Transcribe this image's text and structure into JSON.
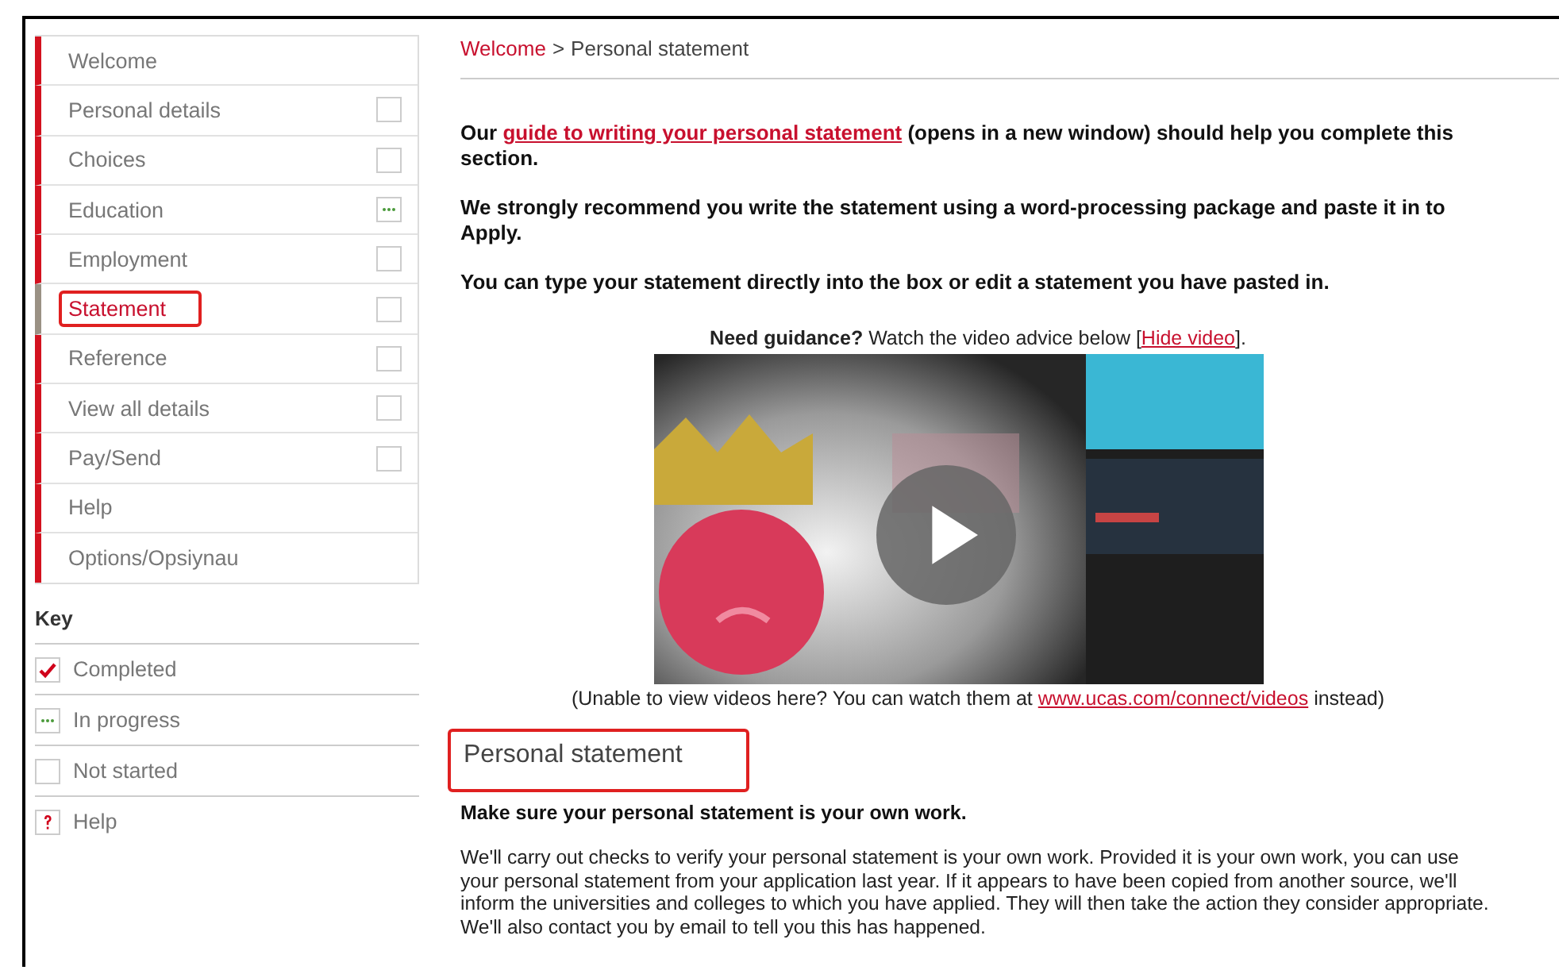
{
  "sidebar": {
    "items": [
      {
        "label": "Welcome",
        "kind": "plain",
        "selected": false,
        "highlighted": false
      },
      {
        "label": "Personal details",
        "kind": "unstarted",
        "selected": false,
        "highlighted": false
      },
      {
        "label": "Choices",
        "kind": "unstarted",
        "selected": false,
        "highlighted": false
      },
      {
        "label": "Education",
        "kind": "underway",
        "selected": false,
        "highlighted": false
      },
      {
        "label": "Employment",
        "kind": "unstarted",
        "selected": false,
        "highlighted": false
      },
      {
        "label": "Statement",
        "kind": "unstarted",
        "selected": true,
        "highlighted": true
      },
      {
        "label": "Reference",
        "kind": "unstarted",
        "selected": false,
        "highlighted": false
      },
      {
        "label": "View all details",
        "kind": "unstarted",
        "selected": false,
        "highlighted": false
      },
      {
        "label": "Pay/Send",
        "kind": "unstarted",
        "selected": false,
        "highlighted": false
      },
      {
        "label": "Help",
        "kind": "plain",
        "selected": false,
        "highlighted": false
      },
      {
        "label": "Options/Opsiynau",
        "kind": "plain",
        "selected": false,
        "highlighted": false
      }
    ]
  },
  "key": {
    "title": "Key",
    "items": [
      {
        "label": "Completed",
        "kind": "completed"
      },
      {
        "label": "In progress",
        "kind": "underway"
      },
      {
        "label": "Not started",
        "kind": "unstarted"
      },
      {
        "label": "Help",
        "kind": "help"
      }
    ]
  },
  "breadcrumb": {
    "link": "Welcome",
    "separator": ">",
    "current": "Personal statement"
  },
  "intro": [
    {
      "before": "Our ",
      "link": "guide to writing your personal statement",
      "after": " (opens in a new window) should help you complete this section."
    },
    {
      "before": "We strongly recommend you write the statement using a word-processing package and paste it in to Apply."
    },
    {
      "before": "You can type your statement directly into the box or edit a statement you have pasted in."
    }
  ],
  "video_note": {
    "bold": "Need guidance?",
    "text": " Watch the video advice below [",
    "link": "Hide video",
    "after": "]."
  },
  "video_caption": {
    "before": "(Unable to view videos here? You can watch them at ",
    "link": "www.ucas.com/connect/videos",
    "after": " instead)"
  },
  "section": {
    "heading": "Personal statement",
    "highlighted": true,
    "lead": "Make sure your personal statement is your own work.",
    "body": "We'll carry out checks to verify your personal statement is your own work. Provided it is your own work, you can use your personal statement from your application last year. If it appears to have been copied from another source, we'll inform the universities and colleges to which you have applied. They will then take the action they consider appropriate. We'll also contact you by email to tell you this has happened."
  }
}
